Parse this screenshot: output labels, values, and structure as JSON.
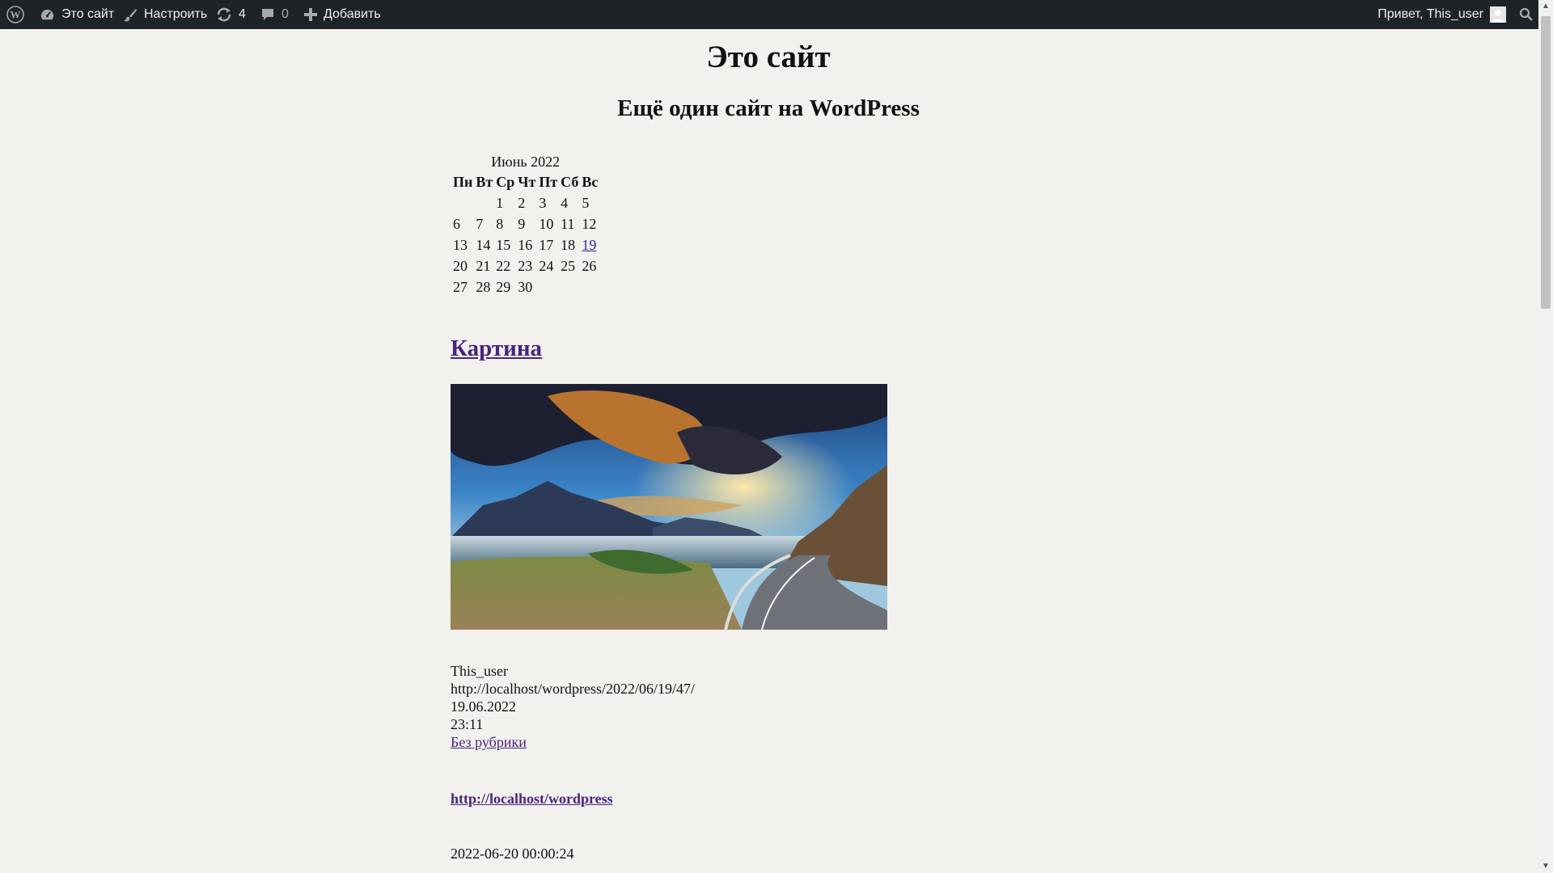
{
  "adminbar": {
    "site_name": "Это сайт",
    "customize": "Настроить",
    "updates_count": "4",
    "comments_count": "0",
    "add_new": "Добавить",
    "greeting": "Привет, This_user"
  },
  "site": {
    "title": "Это сайт",
    "description": "Ещё один сайт на WordPress"
  },
  "calendar": {
    "caption": "Июнь 2022",
    "weekdays": [
      "Пн",
      "Вт",
      "Ср",
      "Чт",
      "Пт",
      "Сб",
      "Вс"
    ],
    "weeks": [
      [
        "",
        "",
        "1",
        "2",
        "3",
        "4",
        "5"
      ],
      [
        "6",
        "7",
        "8",
        "9",
        "10",
        "11",
        "12"
      ],
      [
        "13",
        "14",
        "15",
        "16",
        "17",
        "18",
        "19"
      ],
      [
        "20",
        "21",
        "22",
        "23",
        "24",
        "25",
        "26"
      ],
      [
        "27",
        "28",
        "29",
        "30",
        "",
        "",
        ""
      ]
    ],
    "linked_day": "19"
  },
  "post": {
    "title": "Картина",
    "image_alt": "landscape-road-lake-mountains",
    "author": "This_user",
    "permalink": "http://localhost/wordpress/2022/06/19/47/",
    "date": "19.06.2022",
    "time": "23:11",
    "category": "Без рубрики"
  },
  "footer": {
    "site_url": "http://localhost/wordpress",
    "timestamp": "2022-06-20 00:00:24"
  },
  "colors": {
    "adminbar_bg": "#1d2327",
    "page_bg": "#f2f1ed",
    "link": "#4a2480"
  }
}
